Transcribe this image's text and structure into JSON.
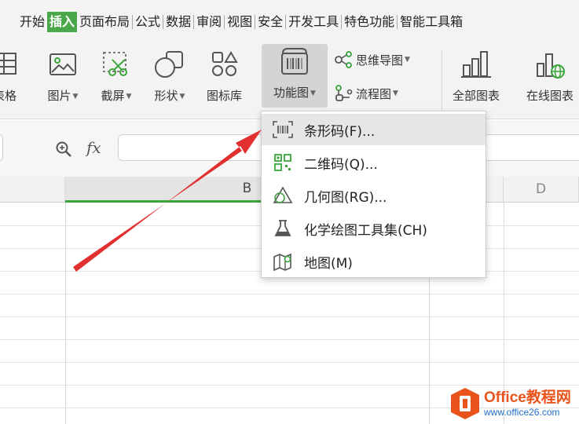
{
  "tabs": [
    "开始",
    "插入",
    "页面布局",
    "公式",
    "数据",
    "审阅",
    "视图",
    "安全",
    "开发工具",
    "特色功能",
    "智能工具箱"
  ],
  "active_tab": "插入",
  "ribbon": {
    "table_label": "表格",
    "picture_label": "图片",
    "screenshot_label": "截屏",
    "shape_label": "形状",
    "iconlib_label": "图标库",
    "function_chart_label": "功能图",
    "mindmap_label": "思维导图",
    "flowchart_label": "流程图",
    "all_charts_label": "全部图表",
    "online_charts_label": "在线图表"
  },
  "formula_bar": {
    "fx_label": "fx",
    "value": ""
  },
  "sheet": {
    "columns": [
      "B",
      "D"
    ],
    "selected_column": "B"
  },
  "dropdown": {
    "items": [
      {
        "label": "条形码(F)...",
        "icon": "barcode-icon"
      },
      {
        "label": "二维码(Q)...",
        "icon": "qrcode-icon"
      },
      {
        "label": "几何图(RG)...",
        "icon": "geometry-icon"
      },
      {
        "label": "化学绘图工具集(CH)",
        "icon": "flask-icon"
      },
      {
        "label": "地图(M)",
        "icon": "map-icon"
      }
    ],
    "highlighted_index": 0
  },
  "watermark": {
    "title": "Office教程网",
    "url": "www.office26.com"
  },
  "colors": {
    "accent_green": "#4aa84a",
    "arrow_red": "#e23030",
    "watermark_orange": "#e8541c",
    "watermark_blue": "#1f6fc7"
  }
}
